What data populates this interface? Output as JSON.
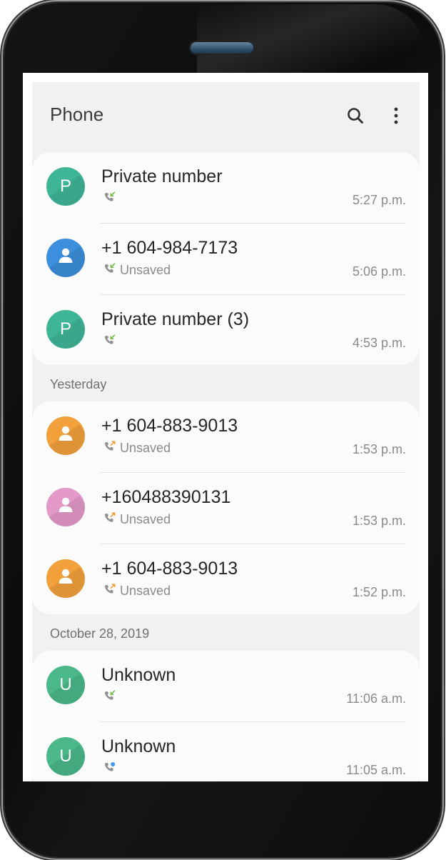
{
  "app": {
    "title": "Phone"
  },
  "colors": {
    "teal": "#3fb597",
    "blue": "#3c8fdc",
    "orange": "#f2a03c",
    "pink": "#e39ac8",
    "green": "#4ab889",
    "incoming_arrow": "#6cc04a",
    "missed_arrow": "#f29a2e",
    "voicemail_dot": "#3d9be9"
  },
  "groups": [
    {
      "header": "",
      "calls": [
        {
          "avatar_type": "letter",
          "letter": "P",
          "name": "Private number",
          "sub": "",
          "call_icon": "incoming-call-icon",
          "time": "5:27 p.m."
        },
        {
          "avatar_type": "person",
          "letter": "",
          "name": "+1 604-984-7173",
          "sub": "Unsaved",
          "call_icon": "incoming-call-icon",
          "time": "5:06 p.m."
        },
        {
          "avatar_type": "letter",
          "letter": "P",
          "name": "Private number (3)",
          "sub": "",
          "call_icon": "incoming-call-icon",
          "time": "4:53 p.m."
        }
      ]
    },
    {
      "header": "Yesterday",
      "calls": [
        {
          "avatar_type": "person",
          "letter": "",
          "name": "+1 604-883-9013",
          "sub": "Unsaved",
          "call_icon": "outgoing-call-icon",
          "time": "1:53 p.m."
        },
        {
          "avatar_type": "person",
          "letter": "",
          "name": "+160488390131",
          "sub": "Unsaved",
          "call_icon": "outgoing-call-icon",
          "time": "1:53 p.m."
        },
        {
          "avatar_type": "person",
          "letter": "",
          "name": "+1 604-883-9013",
          "sub": "Unsaved",
          "call_icon": "outgoing-call-icon",
          "time": "1:52 p.m."
        }
      ]
    },
    {
      "header": "October 28, 2019",
      "calls": [
        {
          "avatar_type": "letter",
          "letter": "U",
          "name": "Unknown",
          "sub": "",
          "call_icon": "incoming-call-icon",
          "time": "11:06 a.m."
        },
        {
          "avatar_type": "letter",
          "letter": "U",
          "name": "Unknown",
          "sub": "",
          "call_icon": "voicemail-call-icon",
          "time": "11:05 a.m."
        }
      ]
    }
  ]
}
